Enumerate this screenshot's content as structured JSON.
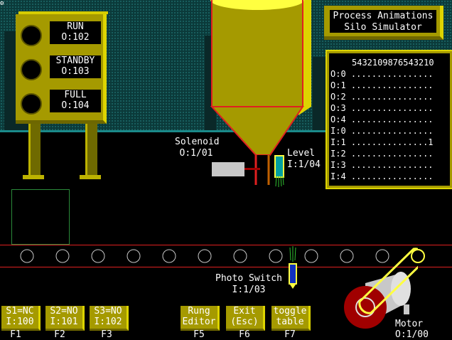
{
  "corner_icon": "gear-icon",
  "title": {
    "line1": "Process Animations",
    "line2": "Silo Simulator"
  },
  "status_panel": {
    "items": [
      {
        "label": "RUN",
        "addr": "O:102"
      },
      {
        "label": "STANDBY",
        "addr": "O:103"
      },
      {
        "label": "FULL",
        "addr": "O:104"
      }
    ]
  },
  "solenoid": {
    "label": "Solenoid",
    "addr": "O:1/01"
  },
  "level": {
    "label": "Level",
    "addr": "I:1/04"
  },
  "photo_switch": {
    "label": "Photo Switch",
    "addr": "I:1/03"
  },
  "motor": {
    "label": "Motor",
    "addr": "O:1/00"
  },
  "io_table": {
    "header": "5432109876543210",
    "rows": [
      {
        "name": "O:0",
        "bits": "................"
      },
      {
        "name": "O:1",
        "bits": "................"
      },
      {
        "name": "O:2",
        "bits": "................"
      },
      {
        "name": "O:3",
        "bits": "................"
      },
      {
        "name": "O:4",
        "bits": "................"
      },
      {
        "name": "I:0",
        "bits": "................"
      },
      {
        "name": "I:1",
        "bits": "...............1"
      },
      {
        "name": "I:2",
        "bits": "................"
      },
      {
        "name": "I:3",
        "bits": "................"
      },
      {
        "name": "I:4",
        "bits": "................"
      }
    ]
  },
  "fkeys": [
    {
      "line1": "S1=NC",
      "line2": "I:100",
      "key": "F1"
    },
    {
      "line1": "S2=NO",
      "line2": "I:101",
      "key": "F2"
    },
    {
      "line1": "S3=NO",
      "line2": "I:102",
      "key": "F3"
    },
    {
      "line1": "Rung",
      "line2": "Editor",
      "key": "F5"
    },
    {
      "line1": "Exit",
      "line2": "(Esc)",
      "key": "F6"
    },
    {
      "line1": "toggle",
      "line2": "table",
      "key": "F7"
    }
  ],
  "colors": {
    "panel": "#a59a00",
    "silo": "#a59a00",
    "wall": "#0b3a3a",
    "conveyor_rail": "#e02020"
  }
}
